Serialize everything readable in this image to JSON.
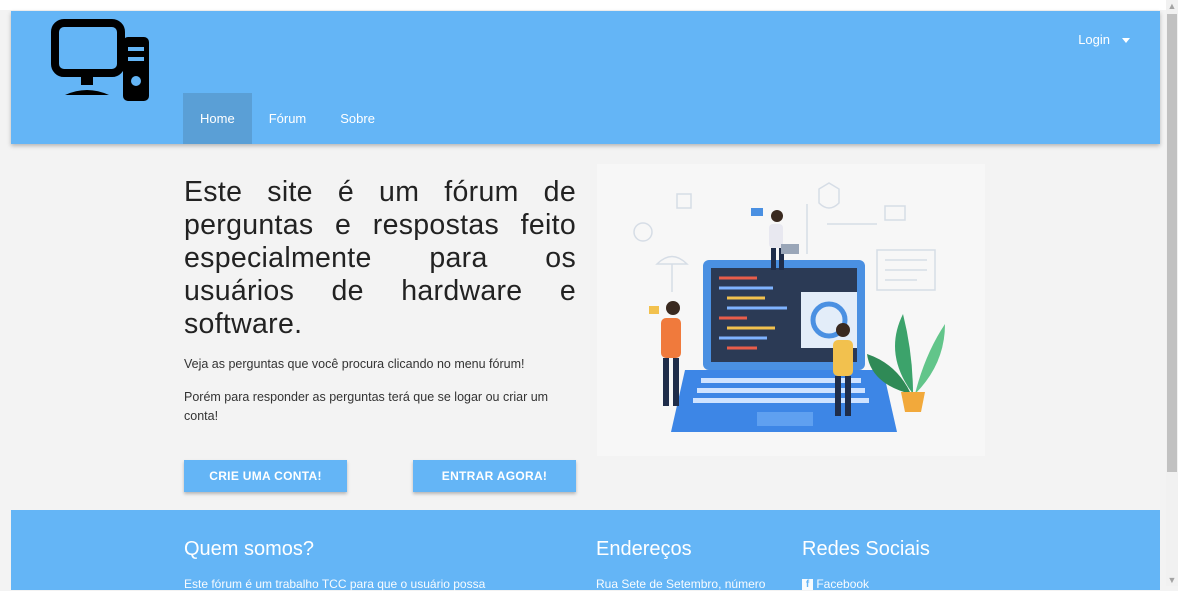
{
  "header": {
    "logo_icon": "computer-monitor-tower-icon",
    "login_label": "Login",
    "nav": [
      {
        "label": "Home",
        "active": true
      },
      {
        "label": "Fórum",
        "active": false
      },
      {
        "label": "Sobre",
        "active": false
      }
    ]
  },
  "hero": {
    "title": "Este site é um fórum de perguntas e respostas feito especialmente para os usuários de hardware e software.",
    "paragraph1": "Veja as perguntas que você procura clicando no menu fórum!",
    "paragraph2": "Porém para responder as perguntas terá que se logar ou criar um conta!",
    "create_button": "CRIE UMA CONTA!",
    "enter_button": "ENTRAR AGORA!",
    "illustration_icon": "developer-laptop-illustration"
  },
  "footer": {
    "about_heading": "Quem somos?",
    "about_text": "Este fórum é um trabalho TCC para que o usuário possa",
    "address_heading": "Endereços",
    "address_text": "Rua Sete de Setembro, número",
    "social_heading": "Redes Sociais",
    "social_facebook": "Facebook",
    "facebook_icon": "facebook-icon"
  },
  "colors": {
    "primary": "#64b5f6",
    "nav_active": "#5a9fd6",
    "background": "#f3f3f3"
  }
}
